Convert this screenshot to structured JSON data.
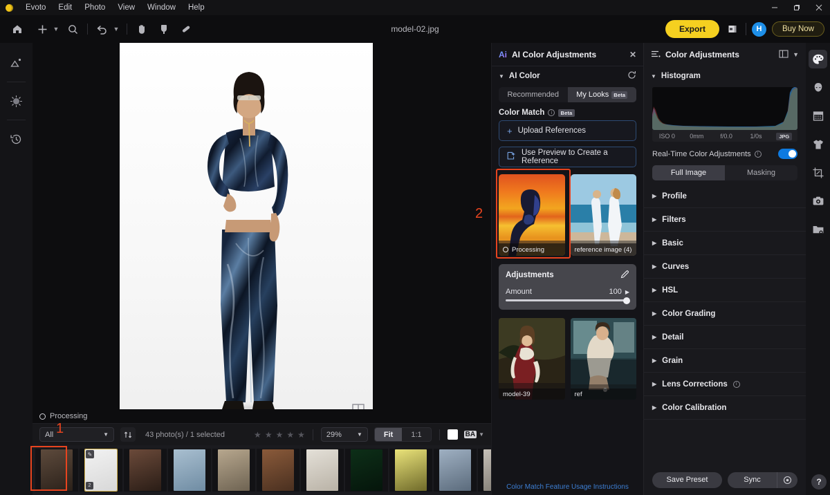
{
  "app": {
    "name": "Evoto",
    "menus": [
      "Evoto",
      "Edit",
      "Photo",
      "View",
      "Window",
      "Help"
    ],
    "document_title": "model-02.jpg"
  },
  "window_controls": {
    "minimize": "—",
    "maximize": "❐",
    "close": "✕"
  },
  "toolbar": {
    "home_icon": "home-icon",
    "add_icon": "plus-icon",
    "search_icon": "search-icon",
    "undo_icon": "undo-icon",
    "hand_icon": "hand-icon",
    "dodge_icon": "dodge-icon",
    "heal_icon": "healing-brush-icon",
    "export_label": "Export",
    "share_icon": "share-icon",
    "avatar_initial": "H",
    "buy_label": "Buy Now"
  },
  "left_rail": [
    {
      "name": "retouch-icon",
      "glyph": "retouch"
    },
    {
      "name": "effects-icon",
      "glyph": "effects"
    },
    {
      "name": "history-icon",
      "glyph": "history"
    }
  ],
  "right_rail": [
    {
      "name": "color-palette-icon",
      "active": true
    },
    {
      "name": "face-icon",
      "active": false
    },
    {
      "name": "background-icon",
      "active": false
    },
    {
      "name": "clothing-icon",
      "active": false
    },
    {
      "name": "crop-icon",
      "active": false
    },
    {
      "name": "camera-icon",
      "active": false
    },
    {
      "name": "folder-icon",
      "active": false
    }
  ],
  "canvas": {
    "status": "Processing",
    "split_view_icon": "split-view-icon"
  },
  "strip_toolbar": {
    "filter_value": "All",
    "sort_icon": "sort-icon",
    "photo_count": "43 photo(s) / 1 selected",
    "star_count": 5,
    "zoom_value": "29%",
    "fit_label": "Fit",
    "one_to_one_label": "1:1",
    "swatch_name": "white-swatch",
    "ba_label": "BA"
  },
  "filmstrip": {
    "selected_index": 1,
    "thumbs": [
      {
        "c1": "#5d4a3c",
        "c2": "#2b211a",
        "edited": false,
        "num": ""
      },
      {
        "c1": "#f2f2f2",
        "c2": "#d8d8d8",
        "edited": true,
        "num": "2"
      },
      {
        "c1": "#6b4a3a",
        "c2": "#2a1d16",
        "edited": false,
        "num": ""
      },
      {
        "c1": "#a9bfd0",
        "c2": "#6f8ca3",
        "edited": false,
        "num": ""
      },
      {
        "c1": "#b7a78e",
        "c2": "#6e6352",
        "edited": false,
        "num": ""
      },
      {
        "c1": "#8a5a3a",
        "c2": "#4a3020",
        "edited": false,
        "num": ""
      },
      {
        "c1": "#e4e0d8",
        "c2": "#b9b2a6",
        "edited": false,
        "num": ""
      },
      {
        "c1": "#0d2f18",
        "c2": "#05150b",
        "edited": false,
        "num": ""
      },
      {
        "c1": "#eae37a",
        "c2": "#6f6a2a",
        "edited": false,
        "num": ""
      },
      {
        "c1": "#9fb0c2",
        "c2": "#5b6b7c",
        "edited": false,
        "num": ""
      },
      {
        "c1": "#c6c0b8",
        "c2": "#7d786f",
        "edited": false,
        "num": ""
      },
      {
        "c1": "#2a2f3a",
        "c2": "#12151c",
        "edited": true,
        "num": ""
      },
      {
        "c1": "#86a05a",
        "c2": "#3d4a26",
        "edited": false,
        "num": ""
      },
      {
        "c1": "#5c7c93",
        "c2": "#28384a",
        "edited": false,
        "num": ""
      },
      {
        "c1": "#8d6a4a",
        "c2": "#3f2e1e",
        "edited": false,
        "num": ""
      },
      {
        "c1": "#7b4fa0",
        "c2": "#3a2250",
        "edited": true,
        "num": ""
      }
    ]
  },
  "ai_panel": {
    "title": "AI Color Adjustments",
    "close_icon": "close-icon",
    "section_title": "AI Color",
    "reset_icon": "reset-icon",
    "tabs": [
      {
        "label": "Recommended",
        "beta": false,
        "active": false
      },
      {
        "label": "My Looks",
        "beta": true,
        "active": true
      }
    ],
    "color_match_label": "Color Match",
    "color_match_beta": "Beta",
    "upload_label": "Upload References",
    "preview_label": "Use Preview to Create a Reference",
    "references": [
      {
        "caption": "Processing",
        "has_ring": true,
        "selected": true
      },
      {
        "caption": "reference image (4)",
        "has_ring": false,
        "selected": false
      }
    ],
    "adjustments": {
      "title": "Adjustments",
      "edit_icon": "edit-pencil-icon",
      "amount_label": "Amount",
      "amount_value": "100",
      "amount_arrow": "▶"
    },
    "library": [
      {
        "caption": "model-39"
      },
      {
        "caption": "ref"
      }
    ],
    "usage_link": "Color Match Feature Usage Instructions",
    "annotation_2": "2"
  },
  "color_panel": {
    "title": "Color Adjustments",
    "layout_icon": "panel-layout-icon",
    "chevron_icon": "chevron-down-icon",
    "histogram_label": "Histogram",
    "histogram_meta": [
      "ISO 0",
      "0mm",
      "f/0.0",
      "1/0s"
    ],
    "histogram_format": "JPG",
    "realtime_label": "Real-Time Color Adjustments",
    "realtime_on": true,
    "view_tabs": [
      {
        "label": "Full Image",
        "active": true
      },
      {
        "label": "Masking",
        "active": false
      }
    ],
    "sections": [
      {
        "label": "Profile",
        "info": false
      },
      {
        "label": "Filters",
        "info": false
      },
      {
        "label": "Basic",
        "info": false
      },
      {
        "label": "Curves",
        "info": false
      },
      {
        "label": "HSL",
        "info": false
      },
      {
        "label": "Color Grading",
        "info": false
      },
      {
        "label": "Detail",
        "info": false
      },
      {
        "label": "Grain",
        "info": false
      },
      {
        "label": "Lens Corrections",
        "info": true
      },
      {
        "label": "Color Calibration",
        "info": false
      }
    ],
    "save_preset_label": "Save Preset",
    "sync_label": "Sync",
    "sync_settings_icon": "settings-gear-icon",
    "help_label": "?"
  },
  "annotations": {
    "one": "1"
  },
  "colors": {
    "accent_yellow": "#f5d020",
    "annotation_red": "#e8441f",
    "toggle_blue": "#0e7ae0",
    "link_blue": "#3d7fd4"
  }
}
